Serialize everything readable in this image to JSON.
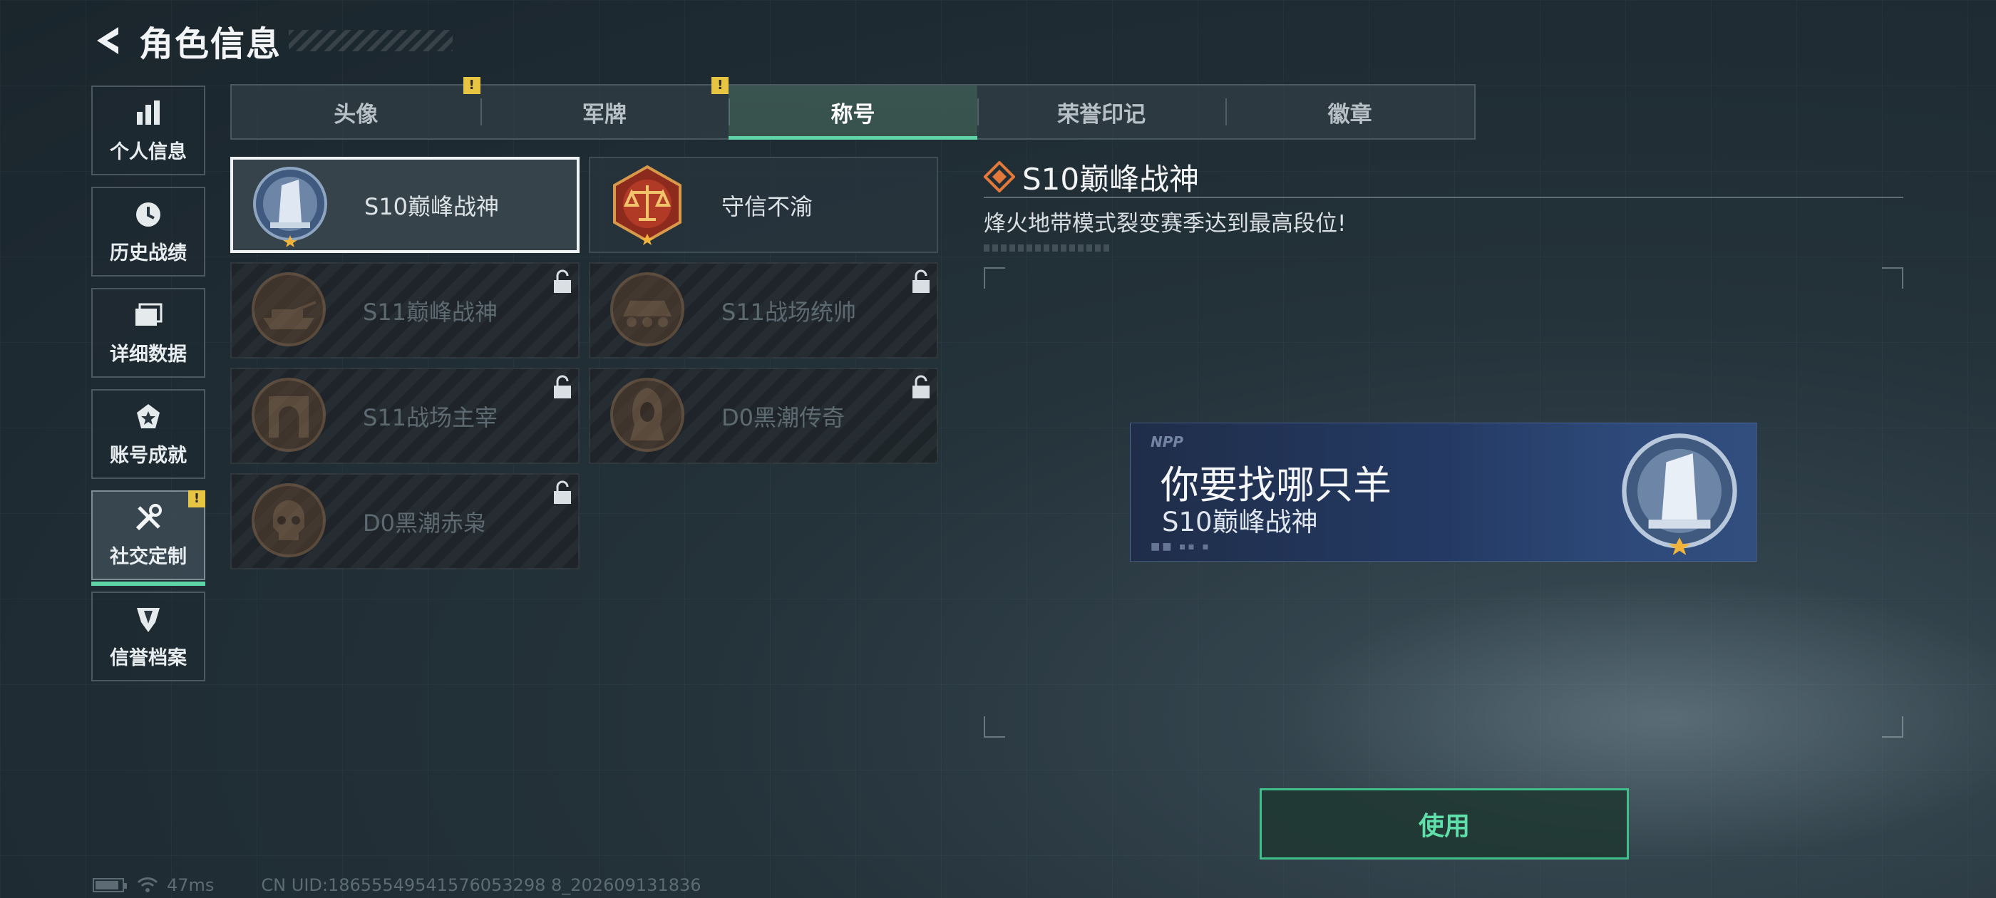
{
  "header": {
    "title": "角色信息"
  },
  "sidenav": {
    "items": [
      {
        "label": "个人信息",
        "icon": "bar-chart-icon",
        "active": false,
        "badge": false
      },
      {
        "label": "历史战绩",
        "icon": "clock-icon",
        "active": false,
        "badge": false
      },
      {
        "label": "详细数据",
        "icon": "folder-icon",
        "active": false,
        "badge": false
      },
      {
        "label": "账号成就",
        "icon": "achievement-icon",
        "active": false,
        "badge": false
      },
      {
        "label": "社交定制",
        "icon": "tools-icon",
        "active": true,
        "badge": true
      },
      {
        "label": "信誉档案",
        "icon": "credit-shield-icon",
        "active": false,
        "badge": false
      }
    ]
  },
  "tabs": [
    {
      "label": "头像",
      "badge": "!"
    },
    {
      "label": "军牌",
      "badge": "!"
    },
    {
      "label": "称号",
      "active": true
    },
    {
      "label": "荣誉印记"
    },
    {
      "label": "徽章"
    }
  ],
  "titles": [
    {
      "label": "S10巅峰战神",
      "medal": "peak-god-medal-icon",
      "locked": false,
      "selected": true
    },
    {
      "label": "守信不渝",
      "medal": "scales-medal-icon",
      "locked": false,
      "selected": false
    },
    {
      "label": "S11巅峰战神",
      "medal": "tank-medal-icon",
      "locked": true
    },
    {
      "label": "S11战场统帅",
      "medal": "apc-medal-icon",
      "locked": true
    },
    {
      "label": "S11战场主宰",
      "medal": "arch-medal-icon",
      "locked": true
    },
    {
      "label": "D0黑潮传奇",
      "medal": "hooded-figure-medal-icon",
      "locked": true
    },
    {
      "label": "D0黑潮赤枭",
      "medal": "skull-medal-icon",
      "locked": true
    }
  ],
  "detail": {
    "title": "S10巅峰战神",
    "description": "烽火地带模式裂变赛季达到最高段位!"
  },
  "banner": {
    "logo": "NPP",
    "player_name": "你要找哪只羊",
    "title": "S10巅峰战神",
    "code": "■■ ▪▪ ▪"
  },
  "use_button": {
    "label": "使用"
  },
  "footer": {
    "ping": "47ms",
    "uid": "CN UID:18655549541576053298 8_202609131836"
  },
  "colors": {
    "accent": "#5fd4a6",
    "warning": "#e8c443",
    "banner": "#243a64"
  }
}
